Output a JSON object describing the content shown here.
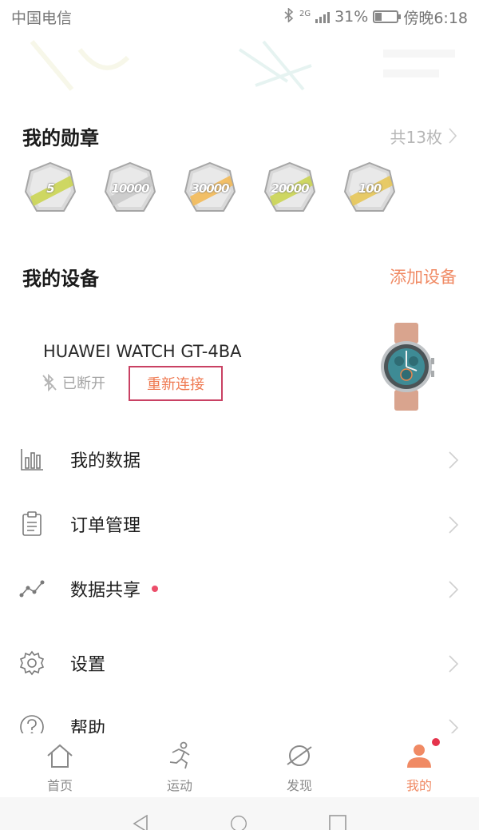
{
  "status_bar": {
    "carrier": "中国电信",
    "network": "2G",
    "battery": "31%",
    "battery_level": 0.31,
    "time": "傍晚6:18"
  },
  "medals": {
    "title": "我的勋章",
    "count": "共13枚",
    "items": [
      {
        "label": "5",
        "accent": "#c9d44a"
      },
      {
        "label": "10000",
        "accent": "#c8c8c8"
      },
      {
        "label": "30000",
        "accent": "#f3b74f"
      },
      {
        "label": "20000",
        "accent": "#c9d44a"
      },
      {
        "label": "100",
        "accent": "#e6c44f"
      }
    ]
  },
  "devices": {
    "title": "我的设备",
    "add_label": "添加设备",
    "device_name": "HUAWEI WATCH GT-4BA",
    "status": "已断开",
    "reconnect_label": "重新连接"
  },
  "menu": {
    "items": [
      {
        "label": "我的数据",
        "icon": "bar-chart-icon"
      },
      {
        "label": "订单管理",
        "icon": "clipboard-icon"
      },
      {
        "label": "数据共享",
        "icon": "share-graph-icon",
        "has_dot": true
      },
      {
        "label": "设置",
        "icon": "gear-icon"
      },
      {
        "label": "帮助",
        "icon": "help-icon"
      }
    ]
  },
  "tabs": [
    {
      "label": "首页",
      "icon": "home-icon"
    },
    {
      "label": "运动",
      "icon": "running-icon"
    },
    {
      "label": "发现",
      "icon": "planet-icon"
    },
    {
      "label": "我的",
      "icon": "person-icon",
      "active": true
    }
  ],
  "colors": {
    "accent": "#f08a64",
    "highlight_border": "#c94163",
    "badge_red": "#e5344c"
  }
}
